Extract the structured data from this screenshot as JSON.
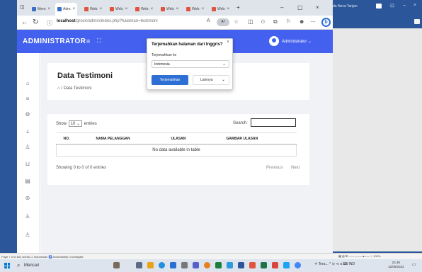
{
  "background_app": {
    "title_text": "da Nova Tanjan",
    "controls": [
      "⊡",
      "–",
      "×"
    ]
  },
  "browser": {
    "tabs": [
      {
        "label": "Mem:",
        "active": false
      },
      {
        "label": "Adm:",
        "active": true
      },
      {
        "label": "Web:",
        "active": false
      },
      {
        "label": "Web:",
        "active": false
      },
      {
        "label": "Web:",
        "active": false
      },
      {
        "label": "Web:",
        "active": false
      },
      {
        "label": "Web:",
        "active": false
      },
      {
        "label": "Web:",
        "active": false
      }
    ],
    "new_tab": "+",
    "window_controls": {
      "minimize": "–",
      "maximize": "▢",
      "close": "×"
    },
    "address": {
      "host": "localhost",
      "path": "/grosir/admin/index.php?halaman=testimoni",
      "translate_badge": "Aʰ"
    }
  },
  "navbar": {
    "brand": "ADMINISTRATOR",
    "menu_icon": "≡",
    "expand_icon": "⛶",
    "user_label": "Administrator ⌄"
  },
  "page": {
    "title": "Data Testimoni",
    "breadcrumb": "/ Data Testimoni"
  },
  "table": {
    "show_prefix": "Show",
    "show_value": "10",
    "show_suffix": "entries",
    "search_label": "Search:",
    "columns": [
      "NO.",
      "NAMA PELANGGAN",
      "ULASAN",
      "GAMBAR ULASAN"
    ],
    "empty_message": "No data available in table",
    "info": "Showing 0 to 0 of 0 entries",
    "previous": "Previous",
    "next": "Next"
  },
  "translate_popup": {
    "title": "Terjemahkan halaman dari Inggris?",
    "target_label": "Terjemahkan ke",
    "target_value": "Indonesia",
    "translate_button": "Terjemahkan",
    "more_button": "Lainnya"
  },
  "statusbar": {
    "left": "Page 7 of 8     841 words     ☐    Indonesian    ♿ Accessibility: Investigate",
    "right": "▦  ▤  ⊞  —————●——  +  100%"
  },
  "taskbar": {
    "search_placeholder": "Mencari",
    "tray_text": "☀ Tera...   ^  ⊙  ⊲  ◂  ⌨  IND",
    "time": "23.39",
    "date": "12/06/2023"
  },
  "colors": {
    "accent": "#4361ee",
    "translate_blue": "#2d6fd3",
    "word_blue": "#2b579a"
  }
}
